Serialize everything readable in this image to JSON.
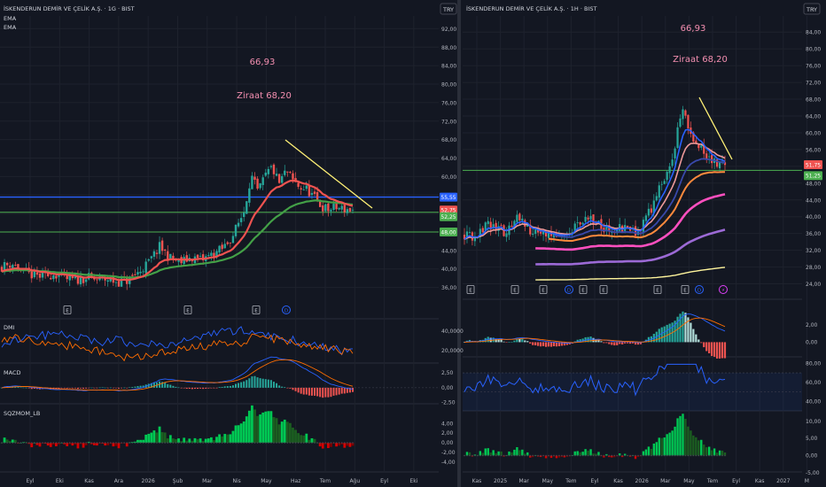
{
  "colors": {
    "bg": "#131722",
    "grid": "#1e222d",
    "axis_text": "#b2b5be",
    "divider": "#2a2e39",
    "up": "#26a69a",
    "down": "#ef5350",
    "ema_fast": "#ef5350",
    "ema_slow": "#43a047",
    "trend": "#fff176",
    "support_green": "#4caf50",
    "resist_blue": "#2962ff",
    "annot": "#f48fb1",
    "dmi_plus": "#2962ff",
    "dmi_minus": "#ff6d00",
    "macd_line": "#2962ff",
    "signal_line": "#ff6d00",
    "rsi_line": "#2962ff",
    "sqz_up": "#00c853",
    "sqz_up_weak": "#1b5e20",
    "sqz_down": "#d50000",
    "sqz_down_weak": "#7f0000",
    "ema_pink": "#ff4fbf",
    "ema_purple": "#9c6ad6",
    "ema_orange": "#ff8a3d",
    "ema_yellow": "#fff59d",
    "ema_blue": "#2962ff",
    "ema_navy": "#3949ab",
    "ema_salmon": "#ef9a9a"
  },
  "left": {
    "title": "İSKENDERUN DEMİR VE ÇELİK A.Ş. · 1G · BIST",
    "legend": [
      "EMA",
      "EMA"
    ],
    "currency_badge": "TRY",
    "annotations": [
      "66,93",
      "Ziraat 68,20"
    ],
    "price_badges": [
      {
        "text": "55,55",
        "value": 55.55,
        "color": "#2962ff"
      },
      {
        "text": "52,75",
        "value": 52.75,
        "color": "#ef5350"
      },
      {
        "text": "52,25",
        "value": 52.25,
        "color": "#4caf50"
      },
      {
        "text": "48,00",
        "value": 48.0,
        "color": "#4caf50"
      }
    ],
    "events": [
      "E",
      "E",
      "E",
      "D"
    ],
    "time_labels": [
      "Eyl",
      "Eki",
      "Kas",
      "Ara",
      "2026",
      "Şub",
      "Mar",
      "Nis",
      "May",
      "Haz",
      "Tem",
      "Ağu",
      "Eyl",
      "Eki"
    ],
    "panes": {
      "dmi": "DMI",
      "macd": "MACD",
      "sqz": "SQZMOM_LB"
    }
  },
  "right": {
    "title": "İSKENDERUN DEMİR VE ÇELİK A.Ş. · 1H · BIST",
    "currency_badge": "TRY",
    "annotations": [
      "66,93",
      "Ziraat 68,20"
    ],
    "price_badges": [
      {
        "text": "51,75",
        "value": 51.75,
        "color": "#ef5350"
      },
      {
        "text": "51,25",
        "value": 51.25,
        "color": "#4caf50"
      }
    ],
    "events": [
      "E",
      "E",
      "E",
      "D",
      "E",
      "E",
      "E",
      "E",
      "D",
      "⚡"
    ],
    "time_labels": [
      "Kas",
      "2025",
      "Mar",
      "May",
      "Tem",
      "Eyl",
      "Kas",
      "2026",
      "Mar",
      "May",
      "Tem",
      "Eyl",
      "Kas",
      "2027",
      "M"
    ]
  },
  "chart_data": [
    {
      "type": "candlestick",
      "interval": "1G",
      "ylim": [
        34,
        94
      ],
      "y_ticks": [
        "92,00",
        "88,00",
        "84,00",
        "80,00",
        "76,00",
        "72,00",
        "68,00",
        "64,00",
        "60,00",
        "56,00",
        "52,00",
        "48,00",
        "44,00",
        "40,00",
        "36,00"
      ],
      "close_path": [
        [
          0.0,
          40.5
        ],
        [
          0.03,
          41.2
        ],
        [
          0.06,
          39.2
        ],
        [
          0.09,
          38.6
        ],
        [
          0.12,
          38.3
        ],
        [
          0.15,
          39.0
        ],
        [
          0.18,
          37.8
        ],
        [
          0.21,
          37.5
        ],
        [
          0.24,
          38.2
        ],
        [
          0.27,
          37.6
        ],
        [
          0.3,
          37.8
        ],
        [
          0.33,
          37.2
        ],
        [
          0.36,
          37.5
        ],
        [
          0.39,
          39.3
        ],
        [
          0.42,
          41.5
        ],
        [
          0.45,
          44.8
        ],
        [
          0.48,
          42.3
        ],
        [
          0.51,
          41.4
        ],
        [
          0.54,
          42.5
        ],
        [
          0.57,
          41.9
        ],
        [
          0.6,
          43.2
        ],
        [
          0.63,
          44.4
        ],
        [
          0.66,
          47.5
        ],
        [
          0.69,
          52.5
        ],
        [
          0.71,
          60.3
        ],
        [
          0.73,
          56.5
        ],
        [
          0.75,
          60.0
        ],
        [
          0.77,
          62.0
        ],
        [
          0.79,
          58.4
        ],
        [
          0.81,
          61.2
        ],
        [
          0.83,
          59.0
        ],
        [
          0.85,
          57.6
        ],
        [
          0.87,
          57.2
        ],
        [
          0.89,
          55.4
        ],
        [
          0.91,
          53.6
        ],
        [
          0.93,
          52.8
        ],
        [
          0.95,
          53.2
        ],
        [
          1.0,
          52.75
        ]
      ],
      "dmi": {
        "ylim": [
          12,
          48
        ],
        "y_ticks": [
          "40,0000",
          "20,0000"
        ]
      },
      "macd": {
        "ylim": [
          -1.8,
          3.4
        ],
        "y_ticks": [
          "2,50",
          "0,00",
          "-2,50"
        ]
      },
      "sqz": {
        "ylim": [
          -5.5,
          7
        ],
        "y_ticks": [
          "4,00",
          "2,00",
          "0,00",
          "-2,00",
          "-4,00"
        ]
      }
    },
    {
      "type": "candlestick",
      "interval": "1H",
      "ylim": [
        22,
        87
      ],
      "y_ticks": [
        "84,00",
        "80,00",
        "76,00",
        "72,00",
        "68,00",
        "64,00",
        "60,00",
        "56,00",
        "52,00",
        "48,00",
        "44,00",
        "40,00",
        "36,00",
        "32,00",
        "28,00",
        "24,00"
      ],
      "close_path": [
        [
          0.0,
          35.8
        ],
        [
          0.04,
          35.2
        ],
        [
          0.08,
          38.0
        ],
        [
          0.12,
          37.6
        ],
        [
          0.16,
          36.0
        ],
        [
          0.2,
          39.5
        ],
        [
          0.24,
          37.5
        ],
        [
          0.28,
          35.6
        ],
        [
          0.32,
          36.4
        ],
        [
          0.36,
          35.8
        ],
        [
          0.4,
          36.5
        ],
        [
          0.44,
          38.2
        ],
        [
          0.48,
          40.2
        ],
        [
          0.52,
          37.8
        ],
        [
          0.56,
          36.8
        ],
        [
          0.6,
          37.5
        ],
        [
          0.64,
          36.0
        ],
        [
          0.68,
          37.2
        ],
        [
          0.72,
          42.5
        ],
        [
          0.76,
          48.0
        ],
        [
          0.8,
          53.0
        ],
        [
          0.82,
          62.0
        ],
        [
          0.84,
          66.9
        ],
        [
          0.86,
          60.5
        ],
        [
          0.88,
          58.5
        ],
        [
          0.9,
          56.3
        ],
        [
          0.92,
          55.2
        ],
        [
          1.0,
          51.75
        ]
      ],
      "macd": {
        "ylim": [
          -1.2,
          4.2
        ],
        "y_ticks": [
          "2,00",
          "0,00"
        ]
      },
      "rsi": {
        "ylim": [
          32,
          84
        ],
        "y_ticks": [
          "80,00",
          "60,00",
          "40,00"
        ]
      },
      "sqz": {
        "ylim": [
          -4,
          12
        ],
        "y_ticks": [
          "10,00",
          "5,00",
          "0,00",
          "-5,00"
        ]
      }
    }
  ]
}
